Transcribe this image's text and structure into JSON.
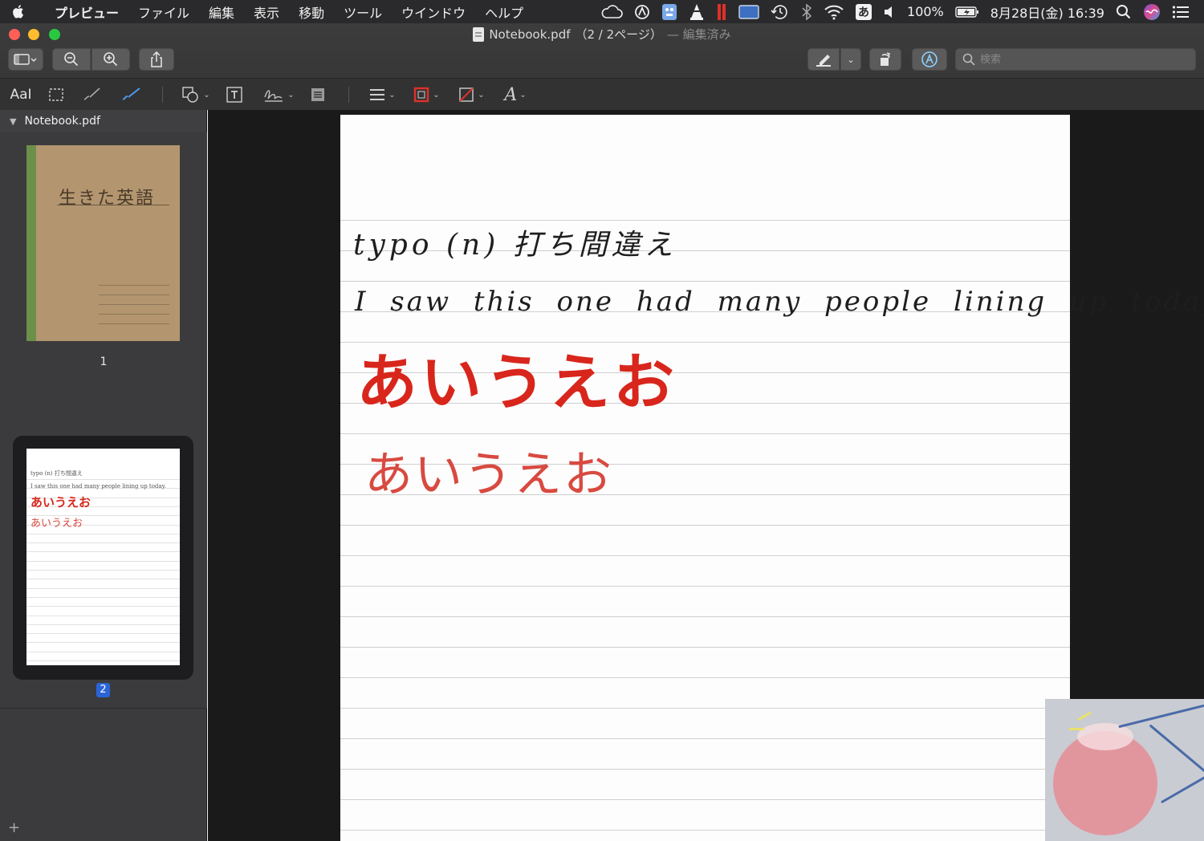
{
  "menubar": {
    "app_name": "プレビュー",
    "menus": [
      "ファイル",
      "編集",
      "表示",
      "移動",
      "ツール",
      "ウインドウ",
      "ヘルプ"
    ],
    "battery": "100%",
    "clock": "8月28日(金)  16:39",
    "input_method": "あ",
    "status_icons": [
      "creative-cloud-icon",
      "vpn-icon",
      "app-icon",
      "vlc-icon",
      "parallels-icon",
      "display-icon",
      "time-machine-icon",
      "bluetooth-icon",
      "wifi-icon",
      "input-method-icon",
      "volume-icon",
      "battery-icon",
      "spotlight-icon",
      "siri-icon",
      "notification-center-icon"
    ]
  },
  "window": {
    "file_name": "Notebook.pdf",
    "page_info": "（2 / 2ページ）",
    "edited_label": "— 編集済み"
  },
  "toolbar": {
    "search_placeholder": "検索",
    "buttons": [
      "sidebar-toggle",
      "zoom-out",
      "zoom-in",
      "share",
      "highlight",
      "rotate",
      "markup"
    ]
  },
  "markup_tools": [
    "text-selection",
    "rect-selection",
    "sketch",
    "draw",
    "shapes",
    "text",
    "sign",
    "note",
    "shape-style",
    "border-color",
    "fill-color",
    "text-style"
  ],
  "sidebar": {
    "header": "Notebook.pdf",
    "pages": [
      {
        "number": "1",
        "cover_title": "生きた英語"
      },
      {
        "number": "2",
        "selected": true
      }
    ]
  },
  "document": {
    "lines": {
      "typo": "typo (n) 打ち間違え",
      "sentence": "I saw this one had many people lining up today.",
      "bold_kana": "あいうえお",
      "thin_kana": "あいうえお"
    },
    "ink_color_black": "#1e1e1e",
    "ink_color_red": "#d8261c"
  }
}
